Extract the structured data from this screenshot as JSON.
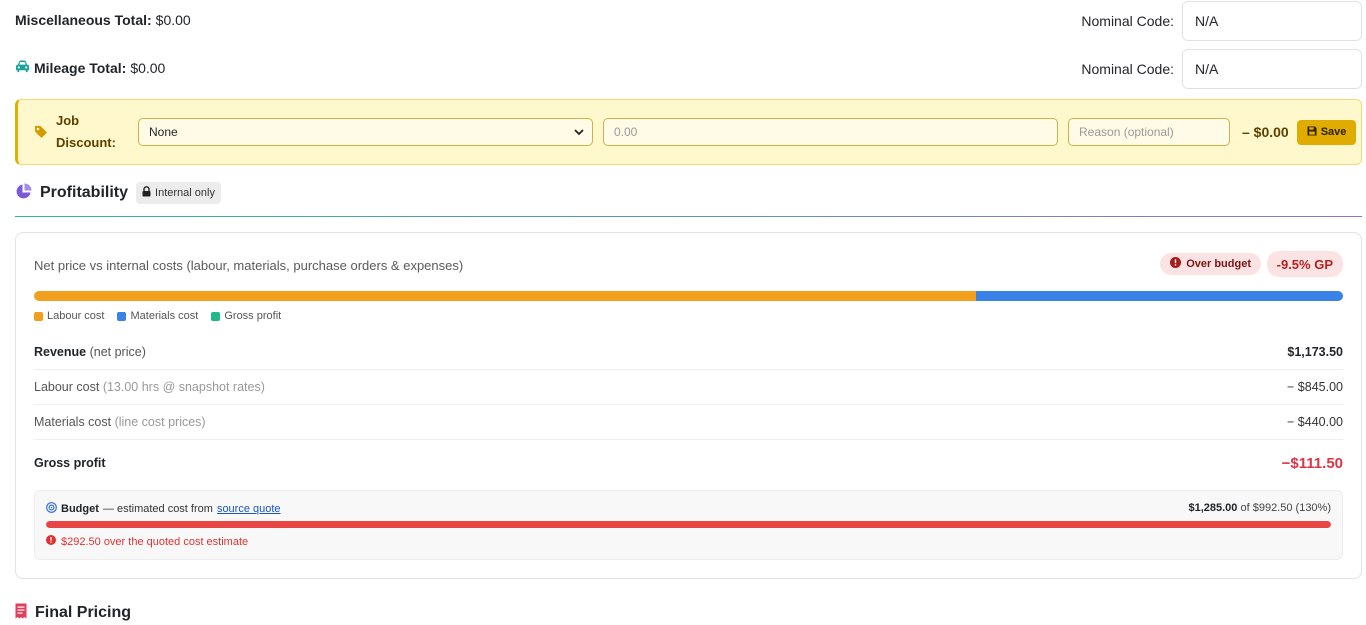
{
  "misc": {
    "label": "Miscellaneous Total:",
    "value": "$0.00",
    "nominal_label": "Nominal Code:",
    "nominal_value": "N/A"
  },
  "mileage": {
    "icon": "car-icon",
    "label": "Mileage Total:",
    "value": "$0.00",
    "nominal_label": "Nominal Code:",
    "nominal_value": "N/A"
  },
  "discount": {
    "icon": "tag-icon",
    "label_line1": "Job",
    "label_line2": "Discount:",
    "type_selected": "None",
    "amount_placeholder": "0.00",
    "reason_placeholder": "Reason (optional)",
    "total": "– $0.00",
    "save_label": "Save"
  },
  "profitability": {
    "icon": "pie-chart-icon",
    "title": "Profitability",
    "internal_badge": "Internal only",
    "subtitle": "Net price vs internal costs (labour, materials, purchase orders & expenses)",
    "over_budget_badge": "Over budget",
    "gp_badge": "-9.5% GP",
    "cost_bar": [
      {
        "name": "Labour cost",
        "fraction": 0.72,
        "color": "#f0a01c"
      },
      {
        "name": "Materials cost",
        "fraction": 0.28,
        "color": "#3b82e6"
      },
      {
        "name": "Gross profit",
        "fraction": 0,
        "color": "#20b98a"
      }
    ],
    "legend": [
      {
        "label": "Labour cost",
        "color": "#f0a01c"
      },
      {
        "label": "Materials cost",
        "color": "#3b82e6"
      },
      {
        "label": "Gross profit",
        "color": "#20b98a"
      }
    ],
    "lines": {
      "revenue": {
        "label": "Revenue",
        "hint": "(net price)",
        "value": "$1,173.50"
      },
      "labour": {
        "label": "Labour cost",
        "hint": "(13.00 hrs @ snapshot rates)",
        "value": "− $845.00"
      },
      "materials": {
        "label": "Materials cost",
        "hint": "(line cost prices)",
        "value": "− $440.00"
      },
      "gross": {
        "label": "Gross profit",
        "value": "−$111.50"
      }
    },
    "budget": {
      "icon": "target-icon",
      "label": "Budget",
      "desc": "— estimated cost from",
      "link": "source quote",
      "actual": "$1,285.00",
      "of_text": "of $992.50 (130%)",
      "fill_fraction": 1.0,
      "warning": "$292.50 over the quoted cost estimate"
    }
  },
  "final": {
    "icon": "receipt-icon",
    "title": "Final Pricing"
  }
}
